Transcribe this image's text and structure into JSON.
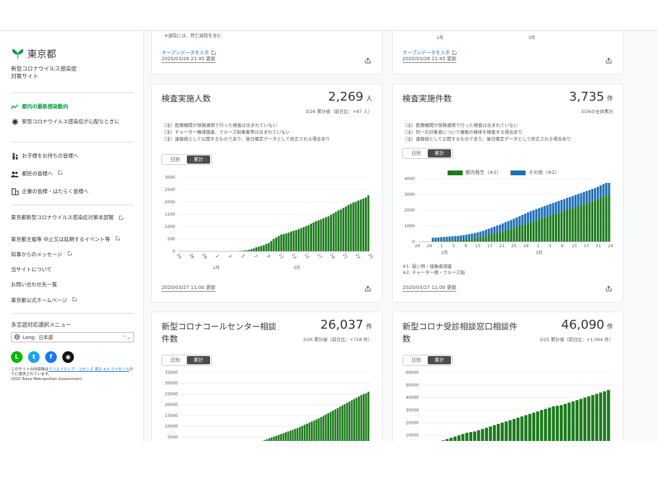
{
  "site": {
    "logo": "東京都",
    "subtitle": "新型コロナウイルス感染症\n対策サイト"
  },
  "nav": [
    {
      "label": "都内の最新感染動向",
      "icon": "trend-icon"
    },
    {
      "label": "新型コロナウイルス感染症が心配なときに",
      "icon": "virus-icon"
    },
    {
      "label": "お子様をお持ちの皆様へ",
      "icon": "family-icon"
    },
    {
      "label": "都民の皆様へ",
      "icon": "people-icon"
    },
    {
      "label": "企業の皆様・はたらく皆様へ",
      "icon": "building-icon"
    },
    {
      "label": "東京都新型コロナウイルス感染症対策本部報"
    },
    {
      "label": "東京都主催等 中止又は延期するイベント等"
    },
    {
      "label": "知事からのメッセージ"
    },
    {
      "label": "当サイトについて"
    },
    {
      "label": "お問い合わせ先一覧"
    },
    {
      "label": "東京都公式ホームページ"
    }
  ],
  "lang": {
    "heading": "多言語対応選択メニュー",
    "label": "Lang:",
    "value": "日本語"
  },
  "license": {
    "prefix": "このサイトの内容物は",
    "link": "クリエイティブ・コモンズ 表示 4.0 ライセンス",
    "suffix": "の下に提供されています。",
    "copyright": "2020 Tokyo Metropolitan Government"
  },
  "top_partial": {
    "note": "※退院には、死亡退院を含む",
    "open_data": "オープンデータを入手",
    "updated": "2020/03/26 21:45 更新",
    "tick_feb": "2月",
    "tick_mar": "3月"
  },
  "toggle": {
    "daily": "日別",
    "cumulative": "累計"
  },
  "colors": {
    "green": "#1b7a1b",
    "blue": "#1f6fb5"
  },
  "cards": {
    "inspected_people": {
      "title": "検査実施人数",
      "value": "2,269",
      "unit": "人",
      "sub": "3/26 累計値（前日比：+87 人）",
      "notes": [
        "（注）医療機関が保険適用で行った検査は含まれていない",
        "（注）チャーター機帰国者、クルーズ船乗客等は含まれていない",
        "（注）速報値として公開するものであり、後日確定データとして修正される場合あり"
      ],
      "updated": "2020/03/27 11:00 更新"
    },
    "inspections": {
      "title": "検査実施件数",
      "value": "3,735",
      "unit": "件",
      "sub": "3/26の全体累計",
      "notes": [
        "（注）医療機関が保険適用で行った検査は含まれていない",
        "（注）同一の対象者について複数の検体を検査する場合あり",
        "（注）速報値として公開するものであり、後日確定データとして修正される場合あり"
      ],
      "legend": [
        "都内発生（※1）",
        "その他（※2）"
      ],
      "annotations": [
        "※1: 疑い例・接触者調査",
        "※2: チャーター便・クルーズ船"
      ],
      "updated": "2020/03/27 11:00 更新"
    },
    "call_center": {
      "title": "新型コロナコールセンター相談件数",
      "value": "26,037",
      "unit": "件",
      "sub": "3/26 累計値（前日比：+718 件）"
    },
    "consultation": {
      "title": "新型コロナ受診相談窓口相談件数",
      "value": "46,090",
      "unit": "件",
      "sub": "3/25 累計値（前日比：+1,064 件）"
    }
  },
  "chart_data": [
    {
      "type": "bar",
      "title": "検査実施人数",
      "ylim": [
        0,
        3000
      ],
      "yticks": [
        0,
        500,
        1000,
        1500,
        2000,
        2500,
        3000
      ],
      "xticks": [
        "24",
        "26",
        "28",
        "1",
        "3",
        "5",
        "7",
        "9",
        "11",
        "13",
        "15",
        "17",
        "19",
        "21",
        "23",
        "25"
      ],
      "month_labels": [
        "2月",
        "3月"
      ],
      "values": [
        0,
        0,
        0,
        0,
        0,
        0,
        0,
        0,
        0,
        0,
        0,
        0,
        0,
        0,
        0,
        0,
        0,
        0,
        0,
        0,
        0,
        0,
        0,
        0,
        10,
        20,
        30,
        40,
        60,
        90,
        120,
        160,
        190,
        220,
        250,
        300,
        340,
        420,
        500,
        560,
        620,
        680,
        700,
        720,
        760,
        800,
        830,
        860,
        900,
        940,
        980,
        1020,
        1060,
        1120,
        1170,
        1220,
        1260,
        1300,
        1340,
        1380,
        1420,
        1480,
        1540,
        1600,
        1660,
        1700,
        1760,
        1820,
        1880,
        1930,
        1980,
        2010,
        2060,
        2100,
        2140,
        2182,
        2269
      ]
    },
    {
      "type": "bar",
      "title": "検査実施件数",
      "ylim": [
        0,
        4000
      ],
      "yticks": [
        0,
        1000,
        2000,
        3000,
        4000
      ],
      "xticks": [
        "24",
        "26",
        "1",
        "5",
        "9",
        "13",
        "17",
        "21",
        "25",
        "29",
        "1",
        "5",
        "9",
        "13",
        "17",
        "21",
        "24"
      ],
      "month_labels": [
        "2月",
        "3月"
      ],
      "series": [
        {
          "name": "都内発生（※1）",
          "values": [
            0,
            0,
            0,
            0,
            0,
            10,
            20,
            30,
            40,
            50,
            60,
            70,
            80,
            90,
            100,
            110,
            130,
            150,
            170,
            190,
            220,
            250,
            290,
            330,
            380,
            420,
            470,
            520,
            560,
            600,
            660,
            720,
            770,
            820,
            880,
            940,
            1000,
            1060,
            1120,
            1180,
            1240,
            1300,
            1360,
            1420,
            1480,
            1540,
            1600,
            1660,
            1720,
            1780,
            1840,
            1900,
            1960,
            2020,
            2080,
            2140,
            2200,
            2260,
            2320,
            2380,
            2440,
            2500,
            2560,
            2620,
            2700,
            2780,
            2860,
            2940,
            3000
          ]
        },
        {
          "name": "その他（※2）",
          "values": [
            0,
            0,
            0,
            0,
            0,
            240,
            240,
            240,
            250,
            250,
            260,
            260,
            260,
            270,
            270,
            280,
            290,
            300,
            310,
            320,
            330,
            340,
            350,
            360,
            380,
            400,
            420,
            440,
            460,
            480,
            500,
            520,
            540,
            560,
            580,
            600,
            620,
            640,
            660,
            680,
            700,
            700,
            710,
            720,
            720,
            730,
            730,
            740,
            740,
            740,
            750,
            750,
            750,
            760,
            760,
            760,
            770,
            770,
            770,
            780,
            780,
            780,
            790,
            790,
            790,
            800,
            800,
            800,
            735
          ]
        }
      ]
    },
    {
      "type": "bar",
      "title": "新型コロナコールセンター相談件数",
      "ylim": [
        0,
        35000
      ],
      "yticks": [
        5000,
        10000,
        15000,
        20000,
        25000,
        30000,
        35000
      ],
      "values": [
        0,
        0,
        0,
        0,
        0,
        0,
        0,
        0,
        0,
        0,
        0,
        0,
        0,
        0,
        0,
        0,
        0,
        0,
        0,
        0,
        0,
        0,
        0,
        0,
        0,
        300,
        600,
        900,
        1200,
        1500,
        1800,
        2100,
        2400,
        2800,
        3200,
        3600,
        4000,
        4400,
        4800,
        5200,
        5600,
        6000,
        6400,
        6800,
        7200,
        7600,
        8000,
        8400,
        8800,
        9200,
        9700,
        10200,
        10700,
        11200,
        11700,
        12200,
        12700,
        13200,
        13700,
        14300,
        14900,
        15500,
        16100,
        16700,
        17300,
        17900,
        18500,
        19100,
        19700,
        20300,
        20900,
        21500,
        22100,
        22700,
        23300,
        23900,
        24500,
        25000,
        25319,
        26037
      ]
    },
    {
      "type": "bar",
      "title": "新型コロナ受診相談窓口相談件数",
      "ylim": [
        0,
        60000
      ],
      "yticks": [
        10000,
        20000,
        30000,
        40000,
        50000,
        60000
      ],
      "values": [
        1000,
        2000,
        3000,
        4000,
        5000,
        6000,
        7000,
        8000,
        9000,
        10000,
        11000,
        12000,
        12500,
        13000,
        14000,
        15000,
        16000,
        17000,
        18000,
        19000,
        20000,
        21000,
        22000,
        23000,
        24000,
        25000,
        26000,
        27000,
        28000,
        29000,
        30000,
        31000,
        32000,
        33000,
        33500,
        34000,
        35000,
        36000,
        37000,
        38000,
        39000,
        40000,
        41000,
        42000,
        43000,
        44000,
        45026,
        46090
      ]
    }
  ]
}
